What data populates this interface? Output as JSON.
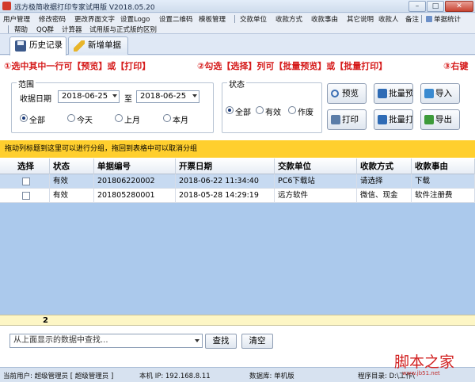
{
  "window": {
    "title": "远方极简收据打印专家试用版 V2018.05.20",
    "buttons": [
      "–",
      "□",
      "✕"
    ]
  },
  "menu": {
    "row1": [
      "用户管理",
      "修改密码",
      "更改界面文字",
      "设置Logo",
      "设置二维码",
      "模板管理",
      "交款单位",
      "收款方式",
      "收款事由",
      "其它说明",
      "收款人",
      "备注",
      "单据统计"
    ],
    "row2": [
      "帮助",
      "QQ群",
      "计算器",
      "试用版与正式版的区别"
    ]
  },
  "tabs": [
    {
      "label": "历史记录",
      "icon": "floppy-disk-icon"
    },
    {
      "label": "新增单据",
      "icon": "pencil-icon"
    }
  ],
  "instructions": [
    "①选中其中一行可【预览】或【打印】",
    "②勾选【选择】列可【批量预览】或【批量打印】",
    "③右键"
  ],
  "range": {
    "group_label": "范围",
    "date_label": "收据日期",
    "date_from": "2018-06-25",
    "to_label": "至",
    "date_to": "2018-06-25",
    "options": [
      "全部",
      "今天",
      "上月",
      "本月"
    ],
    "selected": "全部"
  },
  "status": {
    "group_label": "状态",
    "options": [
      "全部",
      "有效",
      "作废"
    ],
    "selected": "全部"
  },
  "actions": {
    "preview": "预览",
    "batch_preview": "批量预览",
    "import": "导入",
    "print": "打印",
    "batch_print": "批量打印",
    "export": "导出"
  },
  "drag_hint": "拖动列标题到这里可以进行分组，拖回到表格中可以取消分组",
  "table": {
    "columns": [
      "选择",
      "状态",
      "单据编号",
      "开票日期",
      "交款单位",
      "收款方式",
      "收款事由"
    ],
    "rows": [
      {
        "status": "有效",
        "number": "201806220002",
        "date": "2018-06-22 11:34:40",
        "payer": "PC6下载站",
        "method": "请选择",
        "reason": "下载"
      },
      {
        "status": "有效",
        "number": "201805280001",
        "date": "2018-05-28 14:29:19",
        "payer": "远方软件",
        "method": "微信、现金",
        "reason": "软件注册费"
      }
    ],
    "row_count": "2"
  },
  "search": {
    "placeholder": "从上面显示的数据中查找...",
    "find": "查找",
    "clear": "清空"
  },
  "statusbar": {
    "user": "当前用户: 超级管理员 [ 超级管理员 ]",
    "ip": "本机 IP: 192.168.8.11",
    "db": "数据库: 单机版",
    "dir": "程序目录: D:\\工作\\"
  },
  "watermark": {
    "text": "脚本之家",
    "sub": "www.jb51.net"
  },
  "colors": {
    "instruction_red": "#d51a1a",
    "hint_yellow": "#ffcf2e",
    "grid_blue": "#abc9ec",
    "selected_row": "#c7daf1"
  }
}
